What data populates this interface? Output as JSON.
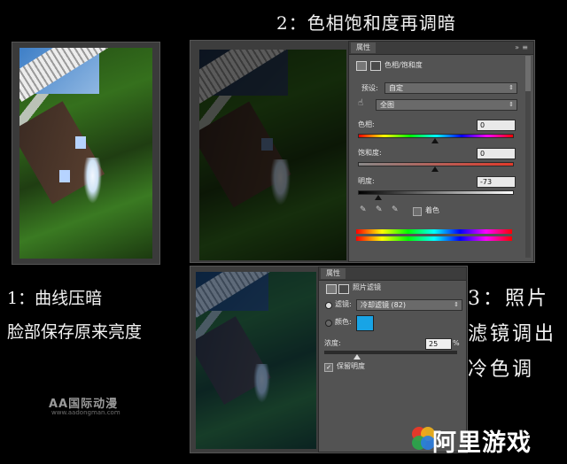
{
  "steps": {
    "step1_line1": "1：曲线压暗",
    "step1_line2": "脸部保存原来亮度",
    "step2": "2：色相饱和度再调暗",
    "step3": "3：照片滤镜调出冷色调"
  },
  "hue_panel": {
    "tab_label": "属性",
    "panel_title": "色相/饱和度",
    "preset_label": "预设:",
    "preset_value": "自定",
    "channel_value": "全图",
    "hue_label": "色相:",
    "hue_value": "0",
    "sat_label": "饱和度:",
    "sat_value": "0",
    "light_label": "明度:",
    "light_value": "-73",
    "colorize_label": "着色",
    "colorize_checked": false,
    "hue_position": 0.5,
    "sat_position": 0.5,
    "light_position": 0.135
  },
  "filter_panel": {
    "tab_label": "属性",
    "panel_title": "照片滤镜",
    "filter_label": "滤镜:",
    "filter_value": "冷却滤镜 (82)",
    "color_label": "颜色:",
    "swatch_color": "#18a4e6",
    "density_label": "浓度:",
    "density_value": "25",
    "density_unit": "%",
    "density_position": 0.25,
    "preserve_label": "保留明度",
    "preserve_checked": true
  },
  "watermarks": {
    "aa_logo": "AA国际动漫",
    "aa_url": "www.aadongman.com",
    "ali_logo": "阿里游戏"
  }
}
